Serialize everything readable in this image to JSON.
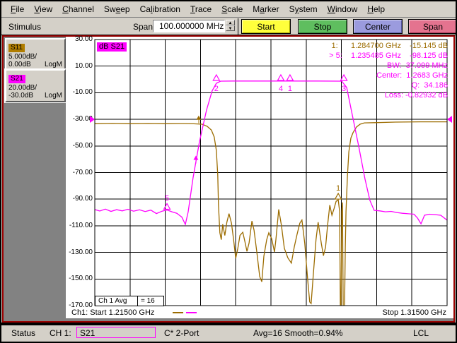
{
  "menu": {
    "items": [
      {
        "label": "File",
        "u": 0
      },
      {
        "label": "View",
        "u": 0
      },
      {
        "label": "Channel",
        "u": 0
      },
      {
        "label": "Sweep",
        "u": 2
      },
      {
        "label": "Calibration",
        "u": 2
      },
      {
        "label": "Trace",
        "u": 0
      },
      {
        "label": "Scale",
        "u": 0
      },
      {
        "label": "Marker",
        "u": 1
      },
      {
        "label": "System",
        "u": 1
      },
      {
        "label": "Window",
        "u": 0
      },
      {
        "label": "Help",
        "u": 0
      }
    ]
  },
  "toolbar": {
    "label": "Stimulus",
    "span_label": "Span",
    "span_value": "100.000000 MHz",
    "buttons": [
      {
        "label": "Start",
        "color": "#FFFF3C"
      },
      {
        "label": "Stop",
        "color": "#5FBE5F"
      },
      {
        "label": "Center",
        "color": "#9B9BDE"
      },
      {
        "label": "Span",
        "color": "#E4738F"
      }
    ]
  },
  "sidebar": {
    "traces": [
      {
        "name": "S11",
        "chip_color": "#B07D00",
        "scale": "5.000dB/",
        "ref": "0.00dB",
        "format": "LogM"
      },
      {
        "name": "S21",
        "chip_color": "#FF00FF",
        "scale": "20.00dB/",
        "ref": "-30.0dB",
        "format": "LogM"
      }
    ]
  },
  "chart_data": {
    "type": "line",
    "title": "dB S21",
    "x_axis": {
      "start_label": "Ch1: Start  1.21500 GHz",
      "stop_label": "Stop  1.31500 GHz",
      "start_ghz": 1.215,
      "stop_ghz": 1.315,
      "divisions": 10
    },
    "y_axis": {
      "tick_labels": [
        "30.00",
        "10.00",
        "-10.00",
        "-30.00",
        "-50.00",
        "-70.00",
        "-90.00",
        "-110.00",
        "-130.00",
        "-150.00",
        "-170.00"
      ],
      "top_db": 30,
      "bottom_db": -170,
      "db_per_div": 20
    },
    "avg_box": {
      "label": "Ch 1 Avg",
      "value": "=   16"
    },
    "readout": {
      "lines": [
        {
          "text": "1:      1.284700 GHz    -15.145 dB",
          "color": "#9C6C00"
        },
        {
          "text": "> 5:    1.235485 GHz    -98.125 dB",
          "color": "#FF00FF"
        },
        {
          "text": "BW:  37.099 MHz",
          "color": "#FF00FF"
        },
        {
          "text": "Center:  1.2683 GHz",
          "color": "#FF00FF"
        },
        {
          "text": "Q:  34.186",
          "color": "#FF00FF"
        },
        {
          "text": "Loss: -0.82932 dB",
          "color": "#FF00FF"
        }
      ]
    },
    "series": [
      {
        "name": "S11",
        "color": "#9C6C00",
        "scale_db_per_div": 5,
        "ref_db": 0,
        "format": "LogM",
        "points": [
          [
            1.215,
            -0.3
          ],
          [
            1.22,
            -0.25
          ],
          [
            1.225,
            -0.3
          ],
          [
            1.2301,
            -0.27
          ],
          [
            1.2351,
            -0.3
          ],
          [
            1.2401,
            -0.28
          ],
          [
            1.2431,
            -0.32
          ],
          [
            1.2455,
            -0.4
          ],
          [
            1.2469,
            -0.8
          ],
          [
            1.2481,
            -1.5
          ],
          [
            1.2489,
            -2.8
          ],
          [
            1.2495,
            -5.3
          ],
          [
            1.2499,
            -9.9
          ],
          [
            1.2501,
            -15.5
          ],
          [
            1.2505,
            -20.8
          ],
          [
            1.2509,
            -22.1
          ],
          [
            1.2513,
            -19.2
          ],
          [
            1.2519,
            -21.3
          ],
          [
            1.2525,
            -18.8
          ],
          [
            1.2531,
            -17.2
          ],
          [
            1.2538,
            -19.0
          ],
          [
            1.2544,
            -22.1
          ],
          [
            1.255,
            -25.6
          ],
          [
            1.2556,
            -23.7
          ],
          [
            1.2562,
            -21.3
          ],
          [
            1.257,
            -20.7
          ],
          [
            1.2576,
            -22.4
          ],
          [
            1.2582,
            -24.3
          ],
          [
            1.2588,
            -22.7
          ],
          [
            1.2596,
            -18.6
          ],
          [
            1.2602,
            -20.3
          ],
          [
            1.261,
            -24.5
          ],
          [
            1.2618,
            -29.0
          ],
          [
            1.2624,
            -30.0
          ],
          [
            1.263,
            -25.2
          ],
          [
            1.2638,
            -22.1
          ],
          [
            1.2644,
            -20.8
          ],
          [
            1.2652,
            -21.9
          ],
          [
            1.266,
            -24.4
          ],
          [
            1.2664,
            -22.1
          ],
          [
            1.2672,
            -16.4
          ],
          [
            1.268,
            -19.5
          ],
          [
            1.2688,
            -23.7
          ],
          [
            1.2698,
            -25.5
          ],
          [
            1.2708,
            -26.5
          ],
          [
            1.2716,
            -23.5
          ],
          [
            1.2724,
            -21.1
          ],
          [
            1.2732,
            -19.0
          ],
          [
            1.2738,
            -18.4
          ],
          [
            1.2746,
            -22.8
          ],
          [
            1.2754,
            -29.4
          ],
          [
            1.276,
            -33.8
          ],
          [
            1.2764,
            -34.1
          ],
          [
            1.277,
            -28.8
          ],
          [
            1.2778,
            -22.1
          ],
          [
            1.2784,
            -18.8
          ],
          [
            1.2793,
            -22.8
          ],
          [
            1.2799,
            -25.1
          ],
          [
            1.2805,
            -23.5
          ],
          [
            1.2811,
            -19.2
          ],
          [
            1.2817,
            -15.6
          ],
          [
            1.2823,
            -17.5
          ],
          [
            1.2829,
            -16.3
          ],
          [
            1.2835,
            -14.9
          ],
          [
            1.2841,
            -14.6
          ],
          [
            1.2845,
            -16.8
          ],
          [
            1.2847,
            -34.5
          ],
          [
            1.2849,
            -34.5
          ],
          [
            1.2851,
            -16.8
          ],
          [
            1.2853,
            -15.1
          ],
          [
            1.2855,
            -34.5
          ],
          [
            1.2859,
            -34.5
          ],
          [
            1.2861,
            -23.5
          ],
          [
            1.2863,
            -16.8
          ],
          [
            1.2867,
            -10.2
          ],
          [
            1.2871,
            -5.6
          ],
          [
            1.2877,
            -3.0
          ],
          [
            1.2883,
            -2.0
          ],
          [
            1.2893,
            -0.9
          ],
          [
            1.2903,
            -0.4
          ],
          [
            1.2915,
            -0.15
          ],
          [
            1.2943,
            -0.1
          ],
          [
            1.3003,
            0.0
          ],
          [
            1.3074,
            0.05
          ],
          [
            1.315,
            0.05
          ]
        ]
      },
      {
        "name": "S21",
        "color": "#FF00FF",
        "scale_db_per_div": 20,
        "ref_db": -30,
        "format": "LogM",
        "points": [
          [
            1.215,
            -97.8
          ],
          [
            1.2164,
            -98.9
          ],
          [
            1.218,
            -97.5
          ],
          [
            1.2196,
            -99.2
          ],
          [
            1.2212,
            -97.9
          ],
          [
            1.2228,
            -98.8
          ],
          [
            1.2244,
            -97.6
          ],
          [
            1.226,
            -99.0
          ],
          [
            1.2277,
            -98.0
          ],
          [
            1.2293,
            -99.3
          ],
          [
            1.2309,
            -98.2
          ],
          [
            1.2325,
            -100.8
          ],
          [
            1.2341,
            -99.0
          ],
          [
            1.2355,
            -98.1
          ],
          [
            1.2369,
            -99.5
          ],
          [
            1.2383,
            -100.6
          ],
          [
            1.2397,
            -103.5
          ],
          [
            1.2407,
            -109.0
          ],
          [
            1.2415,
            -99.5
          ],
          [
            1.2429,
            -74.0
          ],
          [
            1.2447,
            -46.9
          ],
          [
            1.2467,
            -23.1
          ],
          [
            1.2483,
            -8.7
          ],
          [
            1.2495,
            -2.9
          ],
          [
            1.2507,
            -1.3
          ],
          [
            1.2541,
            -1.2
          ],
          [
            1.2602,
            -1.2
          ],
          [
            1.2662,
            -1.2
          ],
          [
            1.2722,
            -1.2
          ],
          [
            1.2782,
            -1.2
          ],
          [
            1.2851,
            -1.3
          ],
          [
            1.2865,
            -6.1
          ],
          [
            1.2879,
            -24.1
          ],
          [
            1.2899,
            -50.1
          ],
          [
            1.2917,
            -75.0
          ],
          [
            1.2931,
            -91.0
          ],
          [
            1.2943,
            -98.4
          ],
          [
            1.2959,
            -98.8
          ],
          [
            1.2975,
            -99.5
          ],
          [
            1.2991,
            -99.2
          ],
          [
            1.3007,
            -100.0
          ],
          [
            1.3023,
            -100.6
          ],
          [
            1.304,
            -101.0
          ],
          [
            1.3056,
            -101.3
          ],
          [
            1.3066,
            -104.2
          ],
          [
            1.3076,
            -108.5
          ],
          [
            1.3086,
            -102.1
          ],
          [
            1.31,
            -101.3
          ],
          [
            1.3116,
            -101.6
          ],
          [
            1.3132,
            -102.1
          ],
          [
            1.315,
            -105.8
          ]
        ]
      }
    ],
    "markers": [
      {
        "trace": "S21",
        "label": "2",
        "f_ghz": 1.2495,
        "db": -1.3,
        "glyph": "triangle",
        "label_pos": "below"
      },
      {
        "trace": "S21",
        "label": "3",
        "f_ghz": 1.2857,
        "db": -1.3,
        "glyph": "triangle",
        "label_pos": "below"
      },
      {
        "trace": "S21",
        "label": "4",
        "f_ghz": 1.2678,
        "db": -1.3,
        "glyph": "triangle",
        "label_pos": "below"
      },
      {
        "trace": "S21",
        "label": "1",
        "f_ghz": 1.2704,
        "db": -1.3,
        "glyph": "triangle",
        "label_pos": "below"
      },
      {
        "trace": "S21",
        "label": "5",
        "f_ghz": 1.23549,
        "db": -98.1,
        "glyph": "triangle",
        "label_pos": "above"
      },
      {
        "trace": "S21",
        "label": "",
        "f_ghz": 1.2437,
        "db": -61.0,
        "glyph": "arrow"
      },
      {
        "trace": "S11",
        "label": "1",
        "f_ghz": 1.2841,
        "db": -14.6,
        "glyph": "triangle",
        "label_pos": "above"
      },
      {
        "trace": "S11",
        "label": "",
        "f_ghz": 1.2445,
        "db": 0.3,
        "glyph": "arrow"
      }
    ],
    "ref_indicator": {
      "trace": "S21",
      "db": -30,
      "color": "#FF00FF"
    },
    "legend_swatches": [
      "#9C6C00",
      "#FF00FF"
    ],
    "grid": true
  },
  "status_bar": {
    "status_label": "Status",
    "channel_label": "CH 1:",
    "trace_name": "S21",
    "cal_status": "C* 2-Port",
    "avg_smooth": "Avg=16 Smooth=0.94%",
    "lcl": "LCL"
  }
}
